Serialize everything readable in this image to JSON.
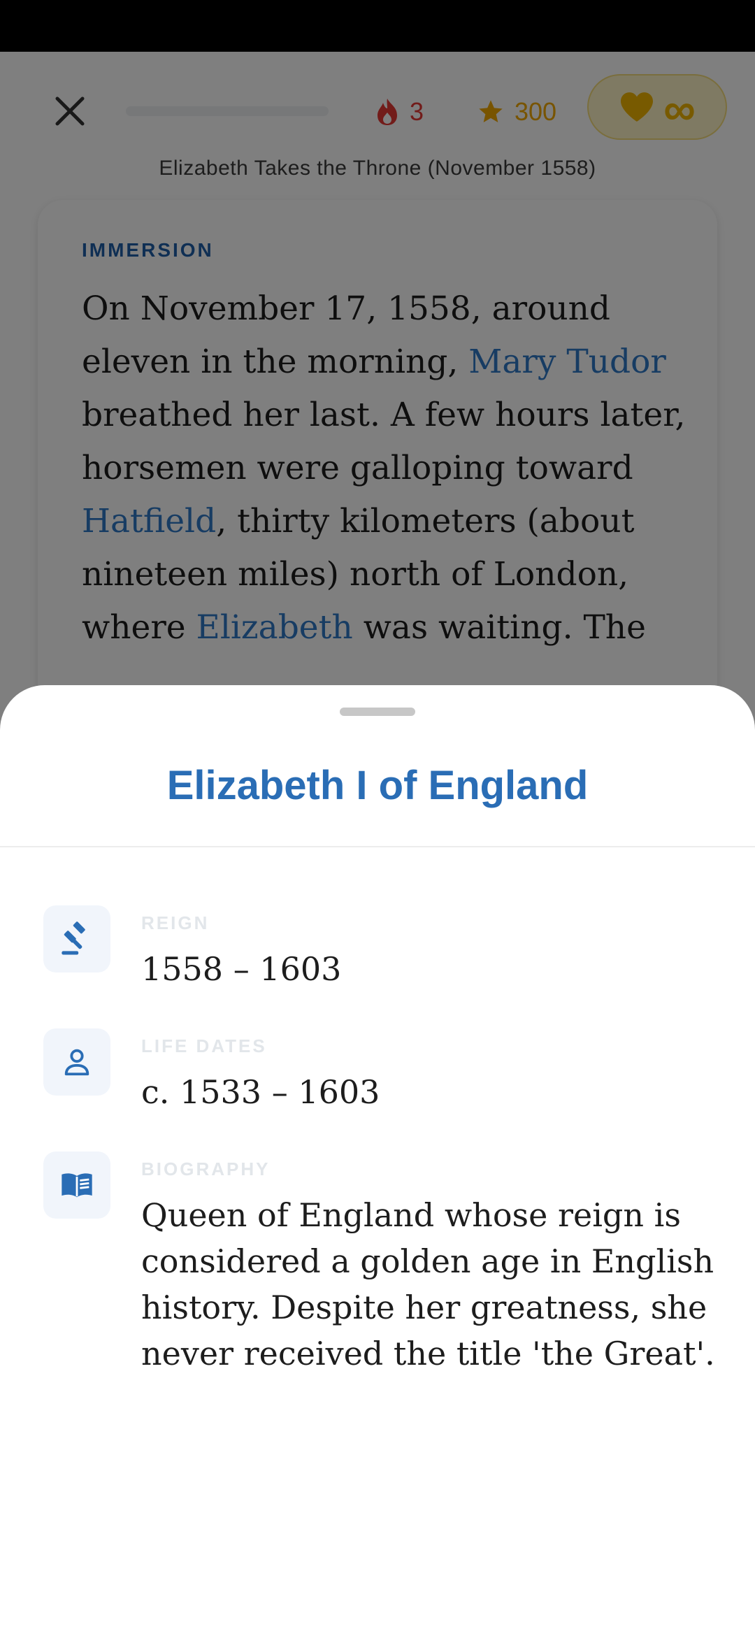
{
  "header": {
    "streak_count": "3",
    "stars_count": "300",
    "hearts_value": "∞",
    "lesson_title": "Elizabeth Takes the Throne (November 1558)"
  },
  "card": {
    "label": "IMMERSION",
    "text_1": "On November 17, 1558, around eleven in the morning, ",
    "link_1": "Mary Tudor",
    "text_2": " breathed her last. A few hours later, horsemen were galloping toward ",
    "link_2": "Hatfield",
    "text_3": ", thirty kilometers (about nineteen miles) north of London, where ",
    "link_3": "Elizabeth",
    "text_4": " was waiting. The"
  },
  "sheet": {
    "title": "Elizabeth I of England",
    "rows": [
      {
        "label": "REIGN",
        "value": "1558 – 1603",
        "icon": "gavel-icon"
      },
      {
        "label": "LIFE DATES",
        "value": "c. 1533 – 1603",
        "icon": "person-icon"
      },
      {
        "label": "BIOGRAPHY",
        "value": "Queen of England whose reign is considered a golden age in English history. Despite her greatness, she never received the title 'the Great'.",
        "icon": "book-icon"
      }
    ]
  },
  "colors": {
    "accent": "#2a6db5",
    "link": "#2f79c7",
    "streak": "#e53935",
    "star": "#f0a800",
    "heart": "#f0b400"
  }
}
